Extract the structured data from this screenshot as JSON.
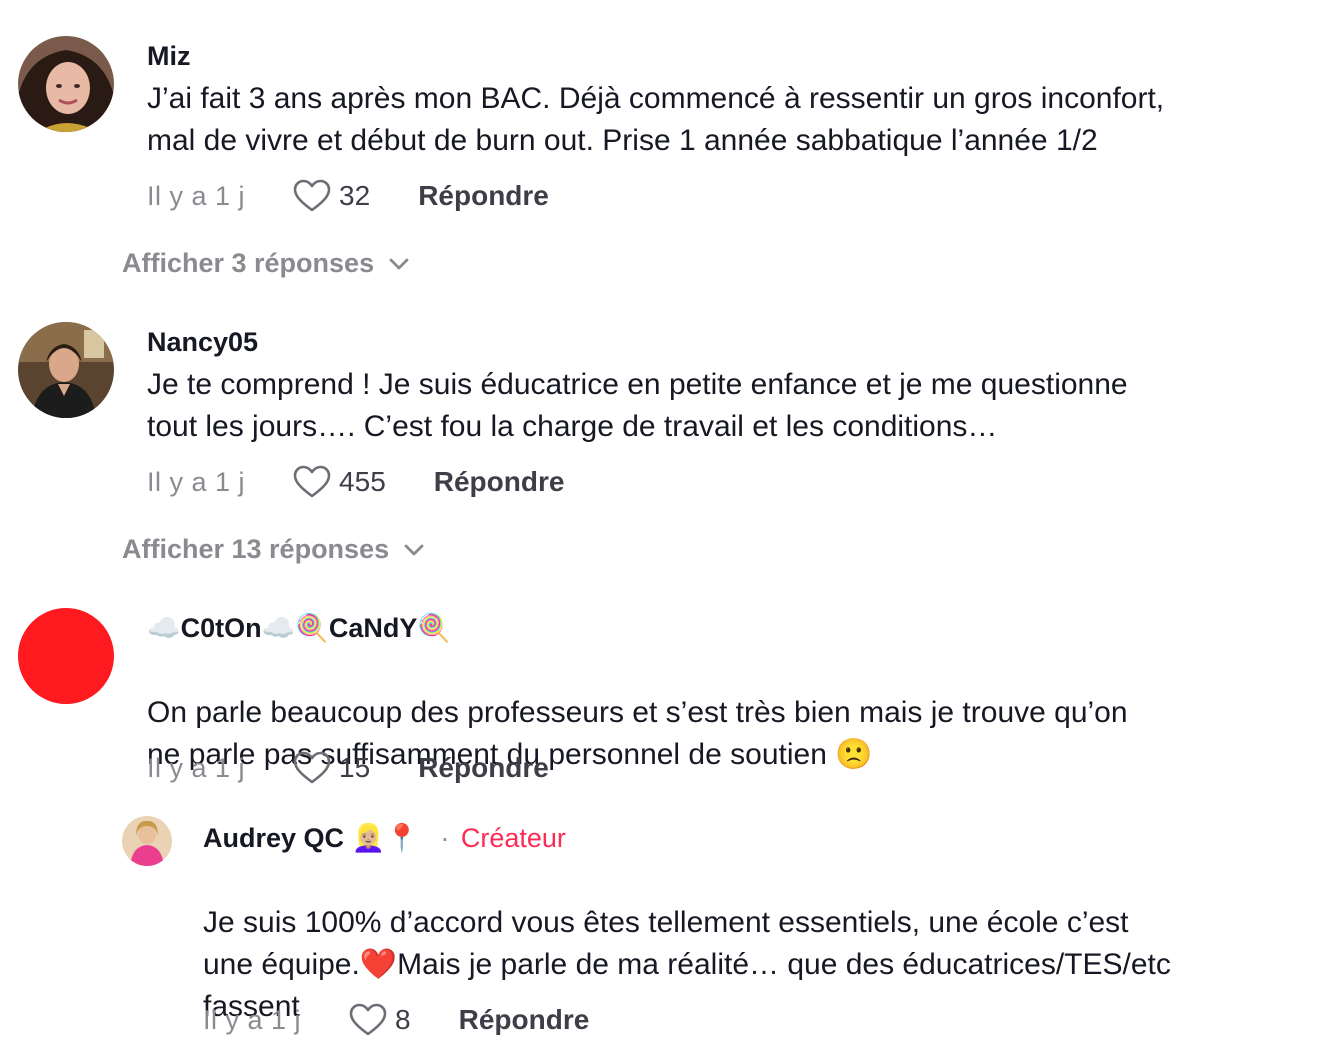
{
  "comments": [
    {
      "username": "Miz",
      "text": "J’ai fait 3 ans après mon BAC. Déjà commencé à ressentir un gros inconfort,\nmal de vivre et début de burn out. Prise 1 année sabbatique l’année 1/2",
      "time": "Il y a 1 j",
      "likes": "32",
      "reply_label": "Répondre",
      "view_replies": "Afficher 3 réponses"
    },
    {
      "username": "Nancy05",
      "text": "Je te comprend ! Je suis éducatrice en petite enfance et je me questionne\ntout les jours…. C’est fou la charge de travail et les conditions…",
      "time": "Il y a 1 j",
      "likes": "455",
      "reply_label": "Répondre",
      "view_replies": "Afficher 13 réponses"
    },
    {
      "username_parts": [
        "☁️",
        "C0tOn",
        "☁️",
        "🍭",
        "CaNdY",
        "🍭"
      ],
      "text": "On parle beaucoup des professeurs et s’est très bien mais je trouve qu’on\nne parle pas suffisamment du personnel de soutien",
      "text_emoji": "🙁",
      "time": "Il y a 1 j",
      "likes": "15",
      "reply_label": "Répondre"
    }
  ],
  "reply": {
    "username": "Audrey QC",
    "username_emojis": "👱🏼‍♀️📍",
    "separator": "·",
    "creator_label": "Créateur",
    "text_part1": "Je suis 100% d’accord vous êtes tellement essentiels, une école c’est\nune équipe.",
    "heart_emoji": "❤️",
    "text_part2": "Mais je parle de ma réalité… que des éducatrices/TES/etc\nfassent",
    "time": "Il y a 1 j",
    "likes": "8",
    "reply_label": "Répondre"
  },
  "colors": {
    "text": "#161823",
    "muted": "#8a8b91",
    "creator": "#fe2c55",
    "red_avatar": "#fe1a1f"
  },
  "icons": [
    "heart-outline-icon",
    "chevron-down-icon"
  ]
}
